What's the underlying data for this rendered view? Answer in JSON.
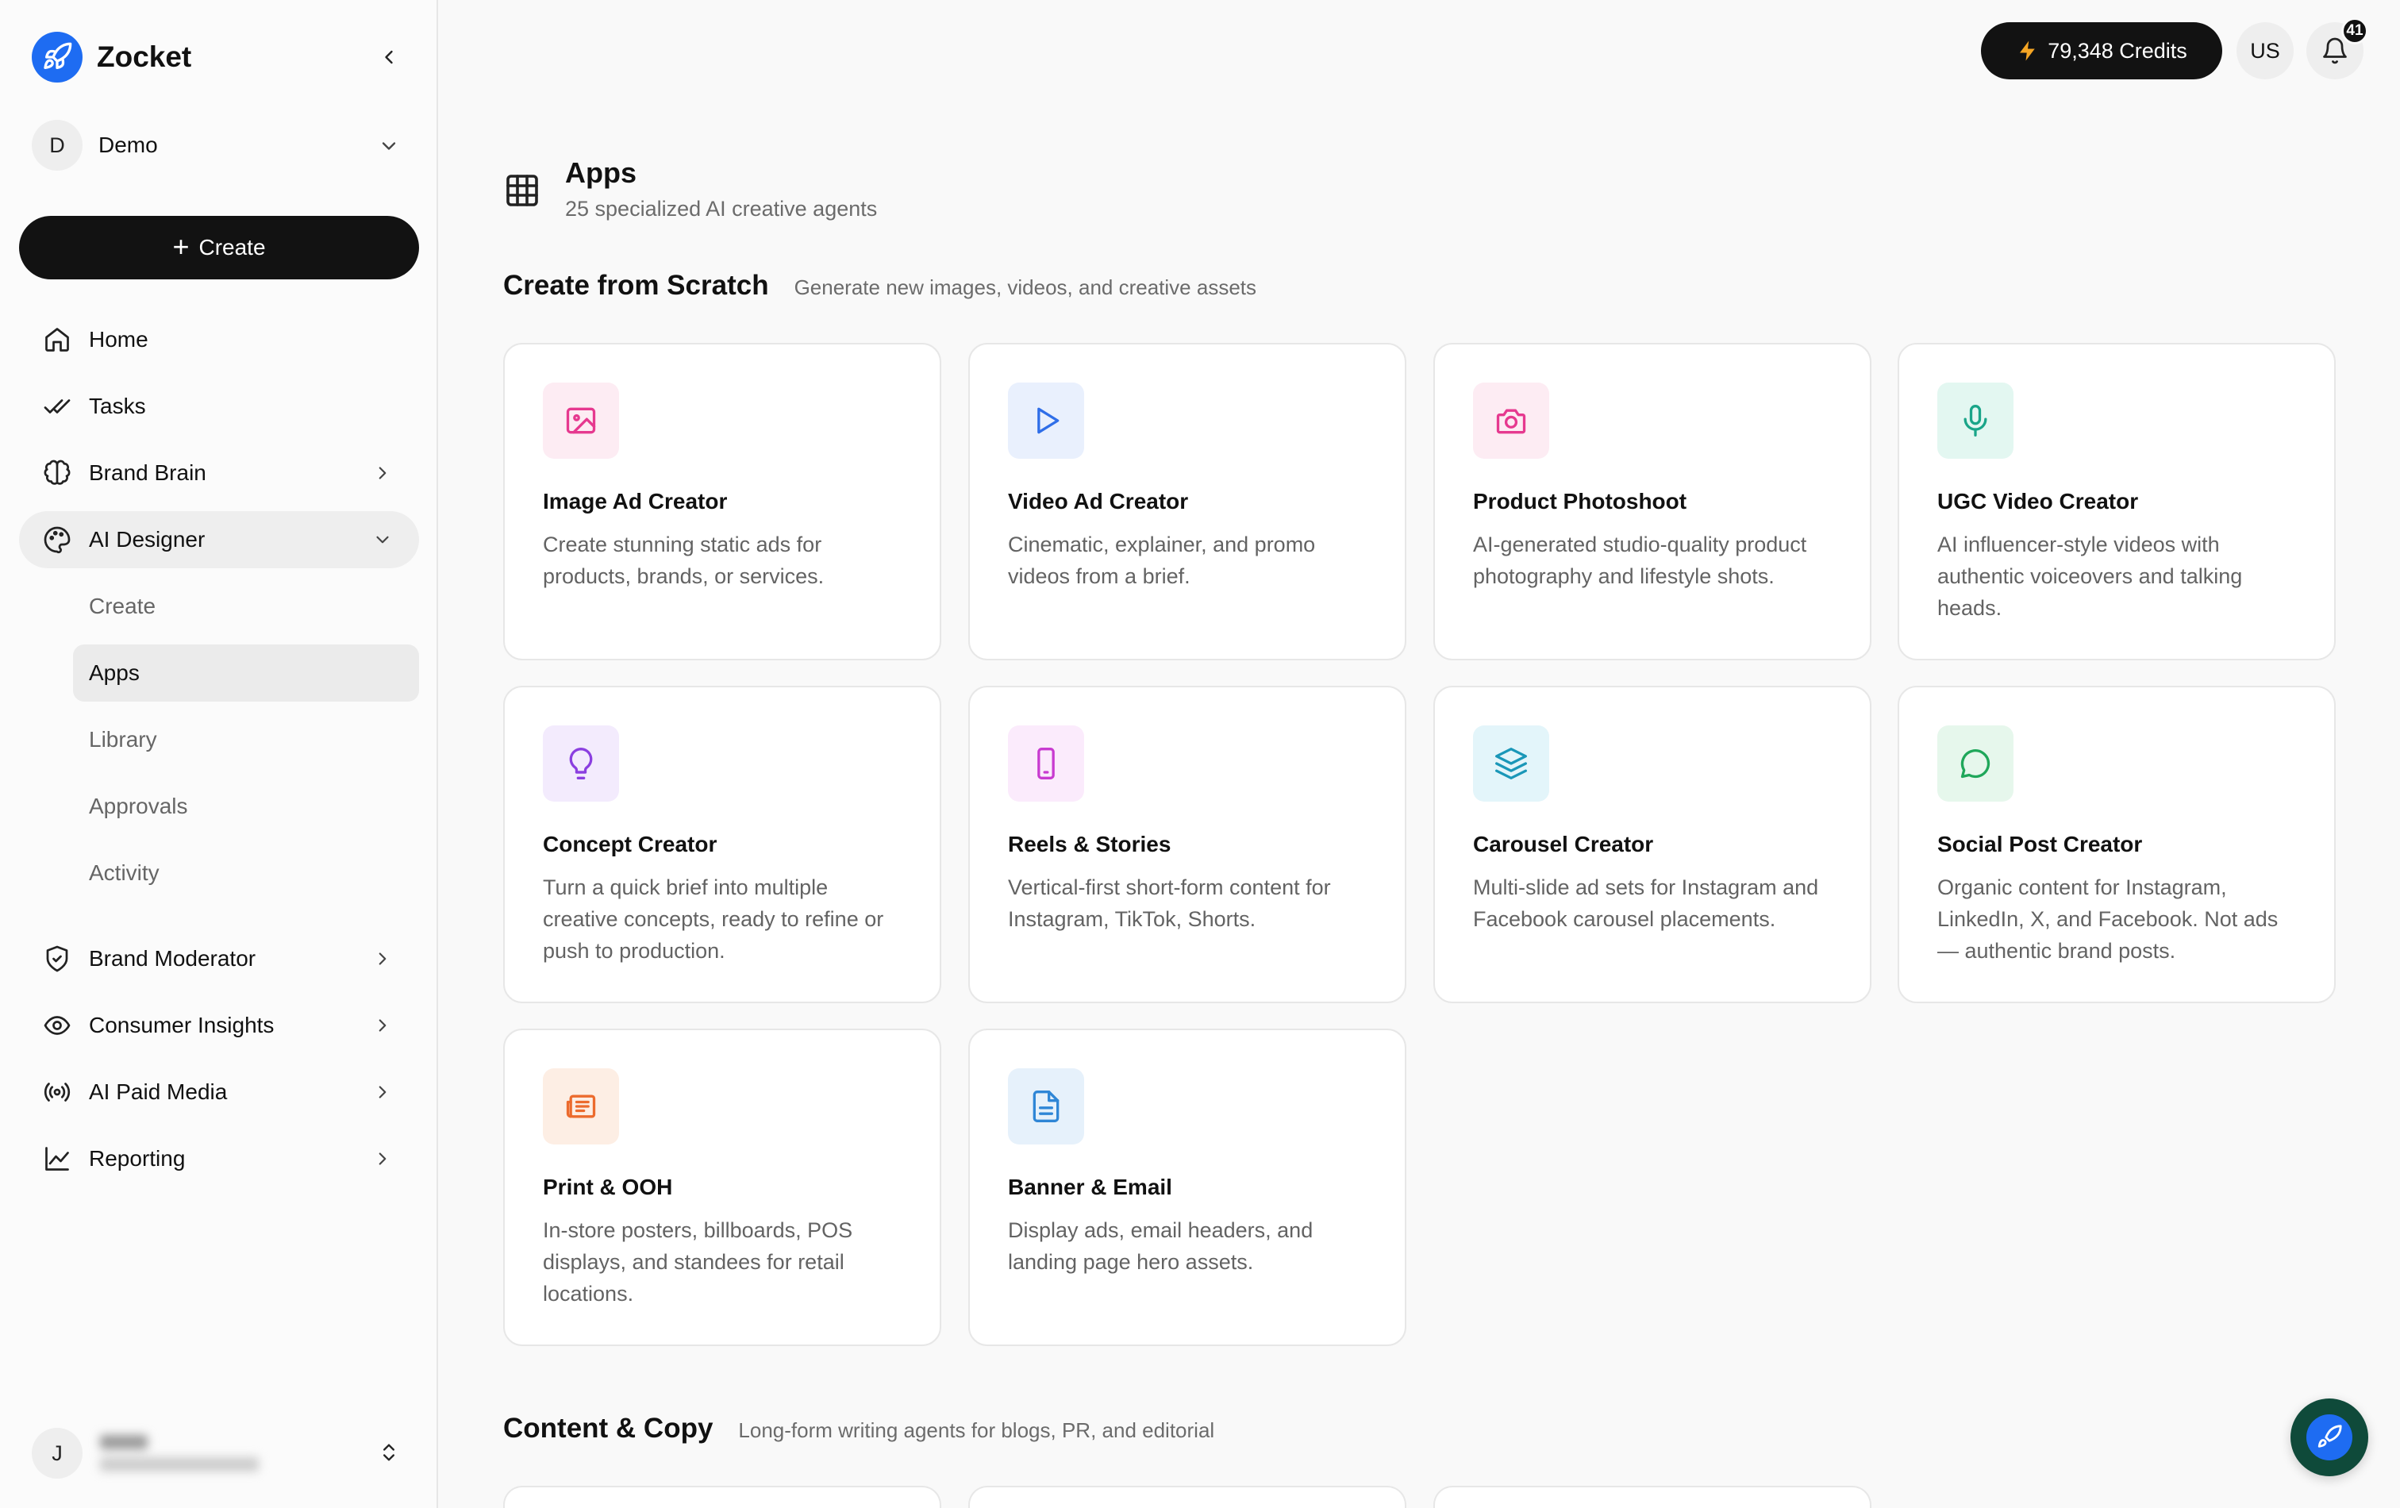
{
  "app": {
    "name": "Zocket"
  },
  "workspace": {
    "initial": "D",
    "name": "Demo"
  },
  "create_label": "Create",
  "nav": {
    "home": "Home",
    "tasks": "Tasks",
    "brand_brain": "Brand Brain",
    "ai_designer": "AI Designer",
    "sub": {
      "create": "Create",
      "apps": "Apps",
      "library": "Library",
      "approvals": "Approvals",
      "activity": "Activity"
    },
    "brand_moderator": "Brand Moderator",
    "consumer_insights": "Consumer Insights",
    "ai_paid_media": "AI Paid Media",
    "reporting": "Reporting"
  },
  "user": {
    "initial": "J"
  },
  "topbar": {
    "credits": "79,348 Credits",
    "region": "US",
    "notifications": "41"
  },
  "page": {
    "title": "Apps",
    "subtitle": "25 specialized AI creative agents"
  },
  "sections": [
    {
      "title": "Create from Scratch",
      "desc": "Generate new images, videos, and creative assets",
      "cards": [
        {
          "title": "Image Ad Creator",
          "desc": "Create stunning static ads for products, brands, or services.",
          "icon": "image-icon",
          "color": "#e6398f",
          "bg": "#fdecf3"
        },
        {
          "title": "Video Ad Creator",
          "desc": "Cinematic, explainer, and promo videos from a brief.",
          "icon": "play-icon",
          "color": "#2f6ee8",
          "bg": "#e9f0fd"
        },
        {
          "title": "Product Photoshoot",
          "desc": "AI-generated studio-quality product photography and lifestyle shots.",
          "icon": "camera-icon",
          "color": "#e6398f",
          "bg": "#fdecf3"
        },
        {
          "title": "UGC Video Creator",
          "desc": "AI influencer-style videos with authentic voiceovers and talking heads.",
          "icon": "microphone-icon",
          "color": "#1aa589",
          "bg": "#e3f7f1"
        },
        {
          "title": "Concept Creator",
          "desc": "Turn a quick brief into multiple creative concepts, ready to refine or push to production.",
          "icon": "lightbulb-icon",
          "color": "#8b3fe0",
          "bg": "#f3ebfd"
        },
        {
          "title": "Reels & Stories",
          "desc": "Vertical-first short-form content for Instagram, TikTok, Shorts.",
          "icon": "phone-icon",
          "color": "#c83bd0",
          "bg": "#fbebfc"
        },
        {
          "title": "Carousel Creator",
          "desc": "Multi-slide ad sets for Instagram and Facebook carousel placements.",
          "icon": "layers-icon",
          "color": "#1a97b8",
          "bg": "#e3f5fa"
        },
        {
          "title": "Social Post Creator",
          "desc": "Organic content for Instagram, LinkedIn, X, and Facebook. Not ads — authentic brand posts.",
          "icon": "chat-bubble-icon",
          "color": "#1fa75a",
          "bg": "#e6f7ec"
        },
        {
          "title": "Print & OOH",
          "desc": "In-store posters, billboards, POS displays, and standees for retail locations.",
          "icon": "newspaper-icon",
          "color": "#ec6b2d",
          "bg": "#fdeee4"
        },
        {
          "title": "Banner & Email",
          "desc": "Display ads, email headers, and landing page hero assets.",
          "icon": "document-icon",
          "color": "#2f86d6",
          "bg": "#e6f1fb"
        }
      ]
    },
    {
      "title": "Content & Copy",
      "desc": "Long-form writing agents for blogs, PR, and editorial"
    }
  ]
}
